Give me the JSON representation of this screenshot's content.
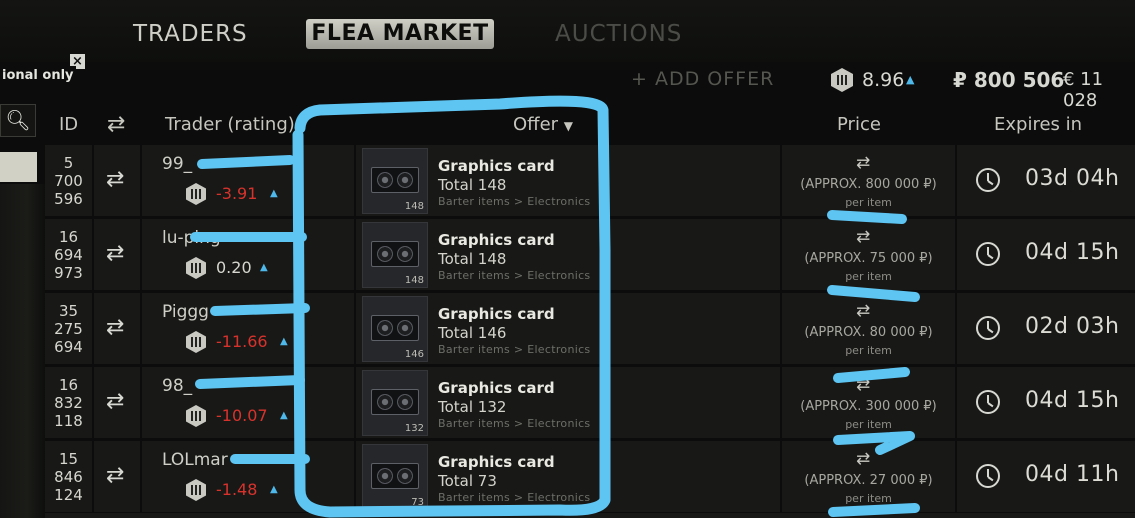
{
  "tabs": {
    "traders": "TRADERS",
    "flea": "FLEA MARKET",
    "auctions": "AUCTIONS"
  },
  "filter": {
    "label": "ional only",
    "close": "×"
  },
  "header_bar": {
    "add_offer": "+ ADD OFFER",
    "btc": "8.96",
    "rub": "₽ 800 506",
    "eur": "€ 11 028"
  },
  "columns": {
    "id": "ID",
    "trader": "Trader (rating)",
    "offer": "Offer",
    "price": "Price",
    "expires": "Expires in"
  },
  "rows": [
    {
      "id": "5\n700\n596",
      "trader": "99_",
      "rating": "-3.91",
      "rating_sign": "neg",
      "item": "Graphics card",
      "total": "Total 148",
      "category": "Barter items > Electronics",
      "count": "148",
      "approx": "(APPROX. 800 000 ₽)",
      "per": "per item",
      "expires": "03d 04h"
    },
    {
      "id": "16\n694\n973",
      "trader": "lu-ping",
      "rating": "0.20",
      "rating_sign": "pos",
      "item": "Graphics card",
      "total": "Total 148",
      "category": "Barter items > Electronics",
      "count": "148",
      "approx": "(APPROX. 75 000 ₽)",
      "per": "per item",
      "expires": "04d 15h"
    },
    {
      "id": "35\n275\n694",
      "trader": "Piggg",
      "rating": "-11.66",
      "rating_sign": "neg",
      "item": "Graphics card",
      "total": "Total 146",
      "category": "Barter items > Electronics",
      "count": "146",
      "approx": "(APPROX. 80 000 ₽)",
      "per": "per item",
      "expires": "02d 03h"
    },
    {
      "id": "16\n832\n118",
      "trader": "98_",
      "rating": "-10.07",
      "rating_sign": "neg",
      "item": "Graphics card",
      "total": "Total 132",
      "category": "Barter items > Electronics",
      "count": "132",
      "approx": "(APPROX. 300 000 ₽)",
      "per": "per item",
      "expires": "04d 15h"
    },
    {
      "id": "15\n846\n124",
      "trader": "LOLmar",
      "rating": "-1.48",
      "rating_sign": "neg",
      "item": "Graphics card",
      "total": "Total 73",
      "category": "Barter items > Electronics",
      "count": "73",
      "approx": "(APPROX. 27 000 ₽)",
      "per": "per item",
      "expires": "04d 11h"
    }
  ],
  "icons": {
    "swap": "swap-icon",
    "clock": "clock-icon",
    "search": "search-icon",
    "coin": "rating-coin-icon",
    "up": "up-arrow-icon"
  },
  "colors": {
    "negative": "#d8322c",
    "accent_blue": "#4fb8ea",
    "annotation": "#5ec4f2"
  }
}
